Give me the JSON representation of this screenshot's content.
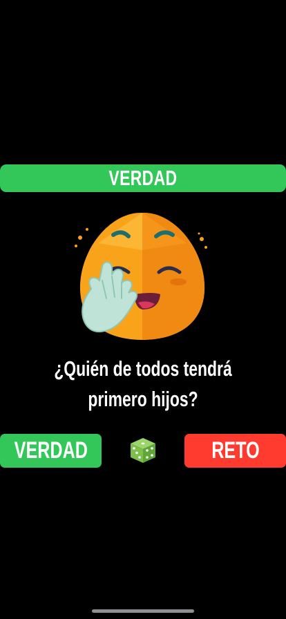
{
  "header": {
    "mode_label": "VERDAD"
  },
  "card": {
    "emoji_icon": "yawning-face-emoji-icon",
    "question_line1": "¿Quién de todos tendrá",
    "question_line2": "primero hijos?"
  },
  "actions": {
    "truth_label": "VERDAD",
    "dare_label": "RETO",
    "random_icon": "dice-icon"
  },
  "colors": {
    "background": "#000000",
    "green": "#33C759",
    "red": "#FF3B30",
    "text": "#FFFFFF",
    "emoji_orange": "#F9A31B"
  }
}
